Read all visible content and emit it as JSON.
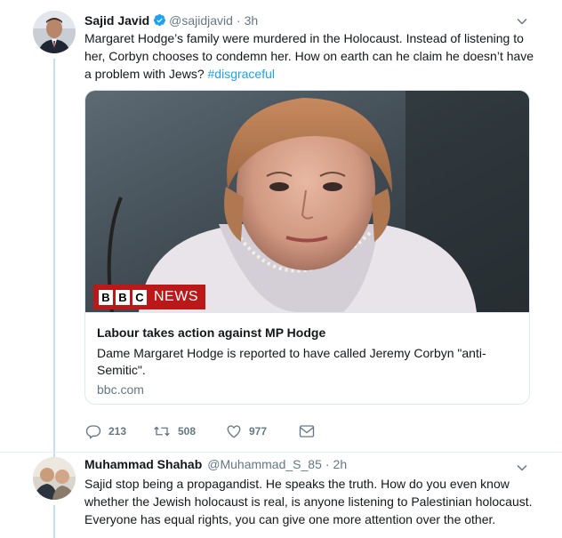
{
  "tweet1": {
    "name": "Sajid Javid",
    "handle": "@sajidjavid",
    "separator": "·",
    "time": "3h",
    "text": "Margaret Hodge’s family were murdered in the Holocaust. Instead of listening to her, Corbyn chooses to condemn her. How on earth can he claim he doesn’t have a problem with Jews?",
    "hashtag": "#disgraceful",
    "card": {
      "logo_letters": [
        "B",
        "B",
        "C"
      ],
      "logo_word": "NEWS",
      "title": "Labour takes action against MP Hodge",
      "description": "Dame Margaret Hodge is reported to have called Jeremy Corbyn \"anti-Semitic\".",
      "domain": "bbc.com"
    },
    "actions": {
      "replies": "213",
      "retweets": "508",
      "likes": "977"
    }
  },
  "tweet2": {
    "name": "Muhammad Shahab",
    "handle": "@Muhammad_S_85",
    "separator": "·",
    "time": "2h",
    "text": "Sajid stop being a propagandist. He speaks  the truth. How do you even know whether the Jewish holocaust is real, is anyone listening to Palestinian holocaust. Everyone has equal rights, you can give one more attention over the other."
  },
  "colors": {
    "accent": "#1da1f2",
    "muted": "#657786",
    "thread": "#c4dfef",
    "bbc_red": "#bb1919"
  },
  "icons": [
    "verified-badge-icon",
    "chevron-down-icon",
    "reply-icon",
    "retweet-icon",
    "like-icon",
    "direct-message-icon"
  ]
}
